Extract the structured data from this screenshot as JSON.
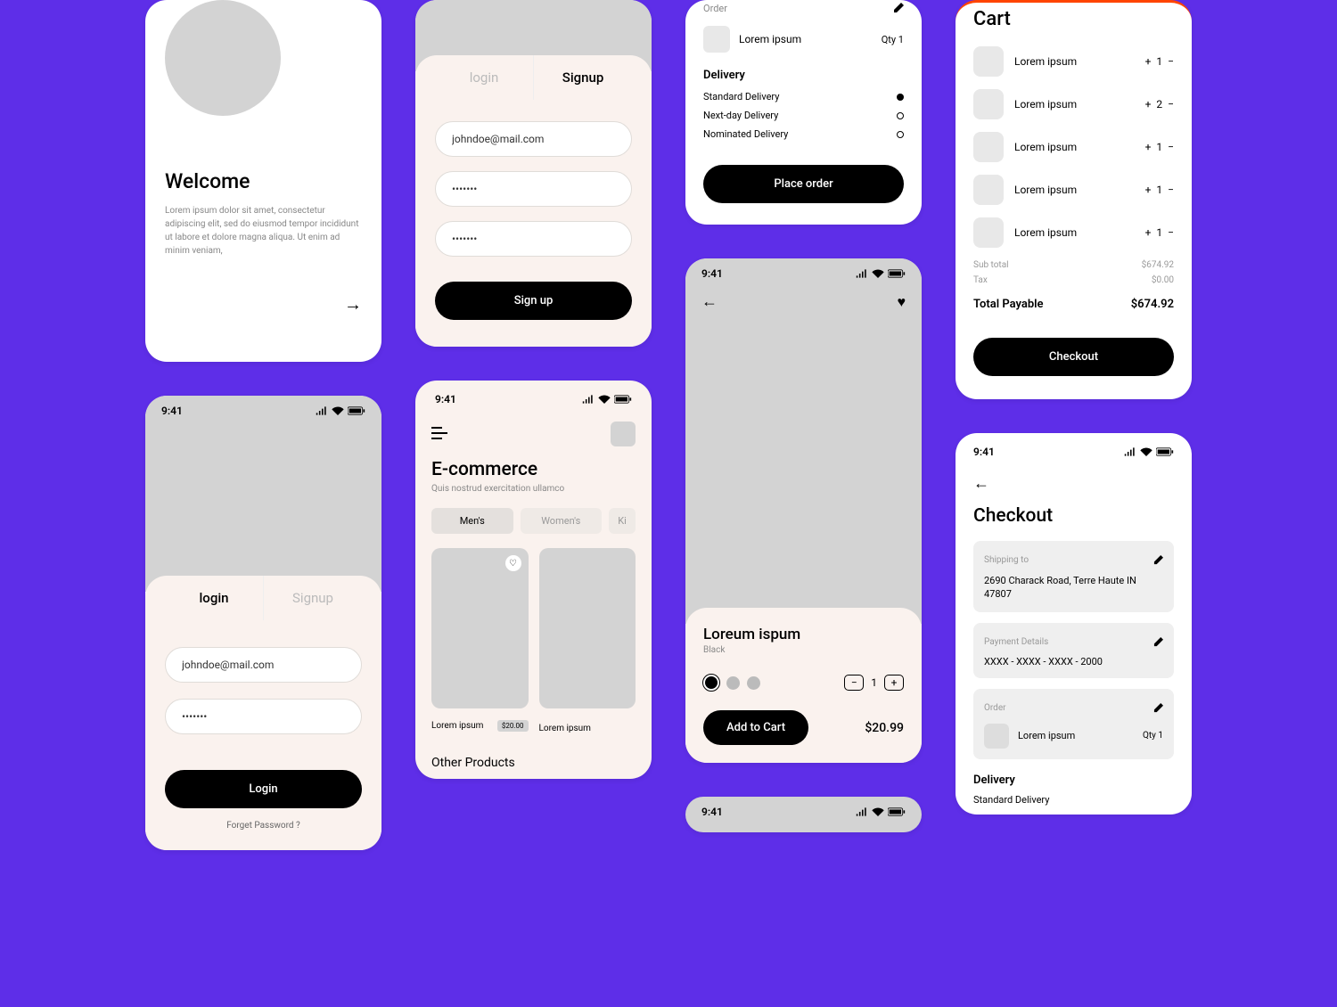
{
  "statusTime": "9:41",
  "welcome": {
    "title": "Welcome",
    "body": "Lorem ipsum dolor sit amet, consectetur adipiscing elit, sed do eiusmod tempor incididunt ut labore et dolore magna aliqua. Ut enim ad minim veniam,"
  },
  "login": {
    "tabLogin": "login",
    "tabSignup": "Signup",
    "email": "johndoe@mail.com",
    "password": "•••••••",
    "loginBtn": "Login",
    "forgot": "Forget Password ?"
  },
  "signup": {
    "tabLogin": "login",
    "tabSignup": "Signup",
    "email": "johndoe@mail.com",
    "password1": "•••••••",
    "password2": "•••••••",
    "signupBtn": "Sign up"
  },
  "ecom": {
    "title": "E-commerce",
    "sub": "Quis nostrud exercitation ullamco",
    "chips": [
      "Men's",
      "Women's",
      "Ki"
    ],
    "prodName": "Lorem ipsum",
    "prodPrice": "$20.00",
    "otherTitle": "Other Products"
  },
  "pdp": {
    "name": "Loreum ispum",
    "color": "Black",
    "qty": "1",
    "addBtn": "Add to Cart",
    "price": "$20.99"
  },
  "checkout1": {
    "orderLabel": "Order",
    "orderItem": "Lorem ipsum",
    "orderQty": "Qty 1",
    "deliveryTitle": "Delivery",
    "options": [
      "Standard Delivery",
      "Next-day Delivery",
      "Nominated Delivery"
    ],
    "placeBtn": "Place order"
  },
  "cart": {
    "title": "Cart",
    "itemName": "Lorem ipsum",
    "qtys": [
      "1",
      "2",
      "1",
      "1",
      "1"
    ],
    "subLabel": "Sub total",
    "subVal": "$674.92",
    "taxLabel": "Tax",
    "taxVal": "$0.00",
    "totalLabel": "Total Payable",
    "totalVal": "$674.92",
    "checkoutBtn": "Checkout"
  },
  "checkout2": {
    "title": "Checkout",
    "shipLabel": "Shipping to",
    "shipAddr": "2690  Charack Road, Terre Haute IN 47807",
    "payLabel": "Payment Details",
    "payVal": "XXXX - XXXX - XXXX - 2000",
    "orderLabel": "Order",
    "orderItem": "Lorem ipsum",
    "orderQty": "Qty 1",
    "deliveryTitle": "Delivery",
    "deliveryOpt": "Standard Delivery"
  }
}
